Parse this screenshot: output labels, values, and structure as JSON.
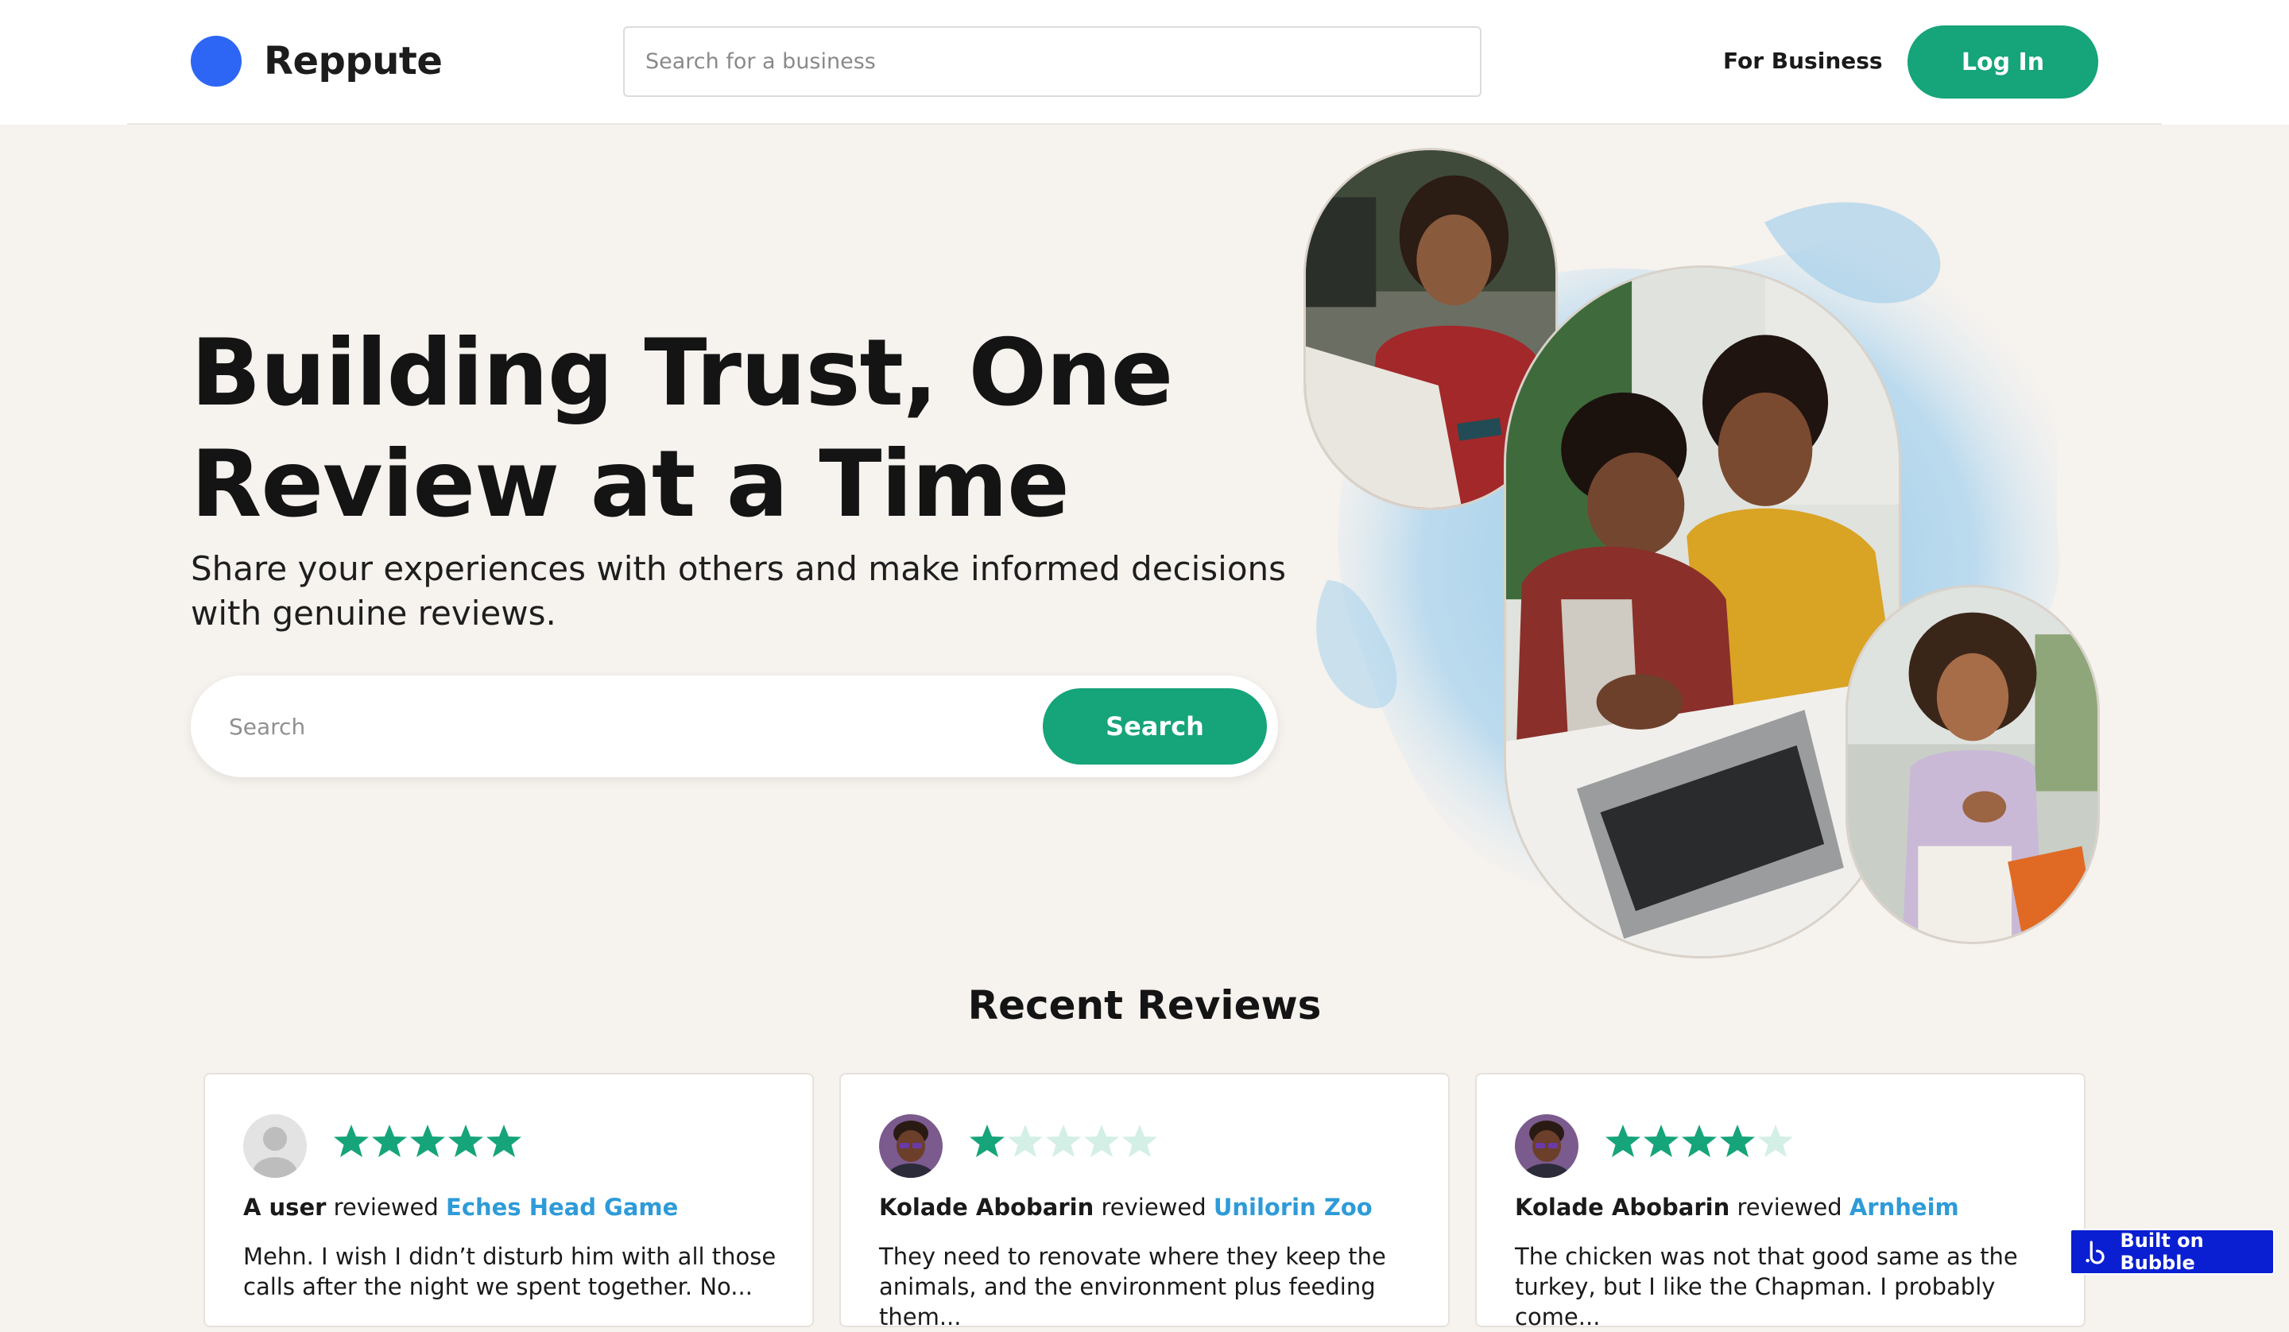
{
  "header": {
    "brand": "Reppute",
    "search_placeholder": "Search for a business",
    "for_business": "For Business",
    "login": "Log In"
  },
  "hero": {
    "title": "Building Trust, One Review at a Time",
    "subtitle": "Share your experiences with others and make informed decisions with genuine reviews.",
    "search_placeholder": "Search",
    "search_button": "Search"
  },
  "reviews": {
    "title": "Recent Reviews",
    "items": [
      {
        "user": "A user",
        "verb": " reviewed ",
        "business": "Eches Head Game",
        "rating": 5,
        "text": "Mehn. I wish I didn’t disturb him with all those calls after the night we spent together. No..."
      },
      {
        "user": "Kolade Abobarin",
        "verb": " reviewed ",
        "business": "Unilorin Zoo",
        "rating": 1,
        "text": "They need to renovate where they keep the animals, and the environment plus feeding them..."
      },
      {
        "user": "Kolade Abobarin",
        "verb": " reviewed ",
        "business": "Arnheim",
        "rating": 4,
        "text": "The chicken was not that good same as the turkey, but I like the Chapman. I probably come..."
      }
    ]
  },
  "badge": {
    "label": "Built on Bubble"
  },
  "colors": {
    "brand_blue": "#2d66f4",
    "accent_green": "#16a47a",
    "link_blue": "#2e9bd8",
    "star_empty": "#d4efe5",
    "page_bg": "#f6f2ee"
  },
  "icons": {
    "logo": "blue-circle-logo",
    "star": "star-icon",
    "avatar_default": "default-user-avatar",
    "avatar_photo": "user-photo-avatar",
    "bubble": "bubble-logo-icon"
  }
}
